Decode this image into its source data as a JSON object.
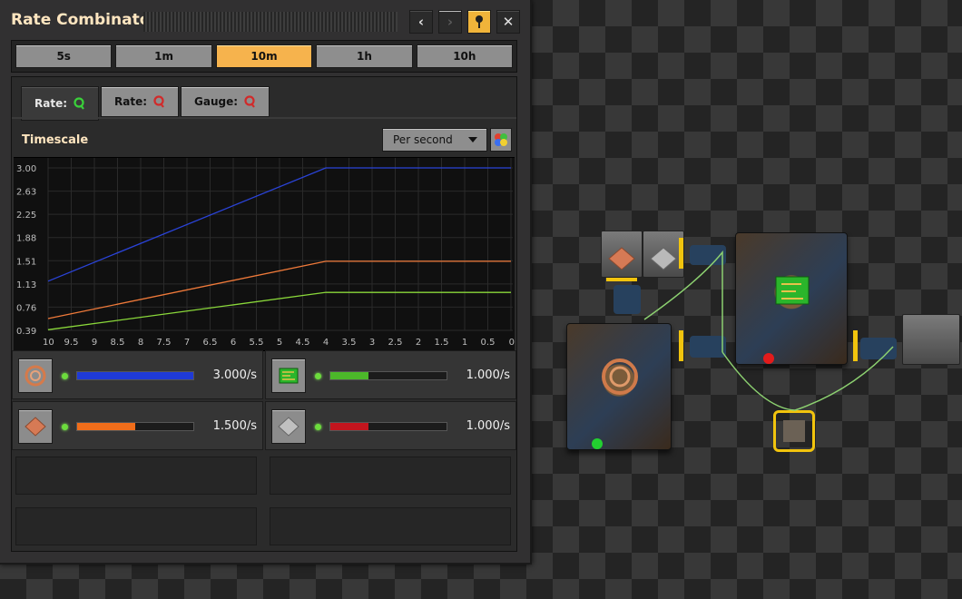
{
  "window": {
    "title": "Rate Combinator",
    "buttons": {
      "back": "‹",
      "forward": "›",
      "close": "✕"
    }
  },
  "intervals": {
    "options": [
      "5s",
      "1m",
      "10m",
      "1h",
      "10h"
    ],
    "selected": "10m"
  },
  "tabs": [
    {
      "label": "Rate:",
      "icon": "green-signal-icon",
      "active": true
    },
    {
      "label": "Rate:",
      "icon": "red-signal-icon",
      "active": false
    },
    {
      "label": "Gauge:",
      "icon": "red-signal-icon",
      "active": false
    }
  ],
  "timescale": {
    "label": "Timescale",
    "selected": "Per second"
  },
  "chart_data": {
    "type": "line",
    "x": [
      10,
      4,
      0
    ],
    "xlim": [
      10,
      0
    ],
    "ylim": [
      0.39,
      3.0
    ],
    "y_ticks": [
      "3.00",
      "2.63",
      "2.25",
      "1.88",
      "1.51",
      "1.13",
      "0.76",
      "0.39"
    ],
    "x_ticks": [
      "10",
      "9.5",
      "9",
      "8.5",
      "8",
      "7.5",
      "7",
      "6.5",
      "6",
      "5.5",
      "5",
      "4.5",
      "4",
      "3.5",
      "3",
      "2.5",
      "2",
      "1.5",
      "1",
      "0.5",
      "0"
    ],
    "grid": true,
    "series": [
      {
        "color": "#2a43d8",
        "values": [
          1.18,
          3.0,
          3.0
        ]
      },
      {
        "color": "#f07a3a",
        "values": [
          0.58,
          1.5,
          1.5
        ]
      },
      {
        "color": "#8ad83a",
        "values": [
          0.4,
          1.0,
          1.0
        ]
      }
    ]
  },
  "signals": [
    {
      "icon": "copper-cable-icon",
      "value": "3.000/s",
      "fill": 1.0,
      "color": "#1f3ad6"
    },
    {
      "icon": "electronic-circuit-icon",
      "value": "1.000/s",
      "fill": 0.33,
      "color": "#4cb82a"
    },
    {
      "icon": "copper-plate-icon",
      "value": "1.500/s",
      "fill": 0.5,
      "color": "#f06d1a"
    },
    {
      "icon": "iron-plate-icon",
      "value": "1.000/s",
      "fill": 0.33,
      "color": "#c3151e"
    }
  ]
}
